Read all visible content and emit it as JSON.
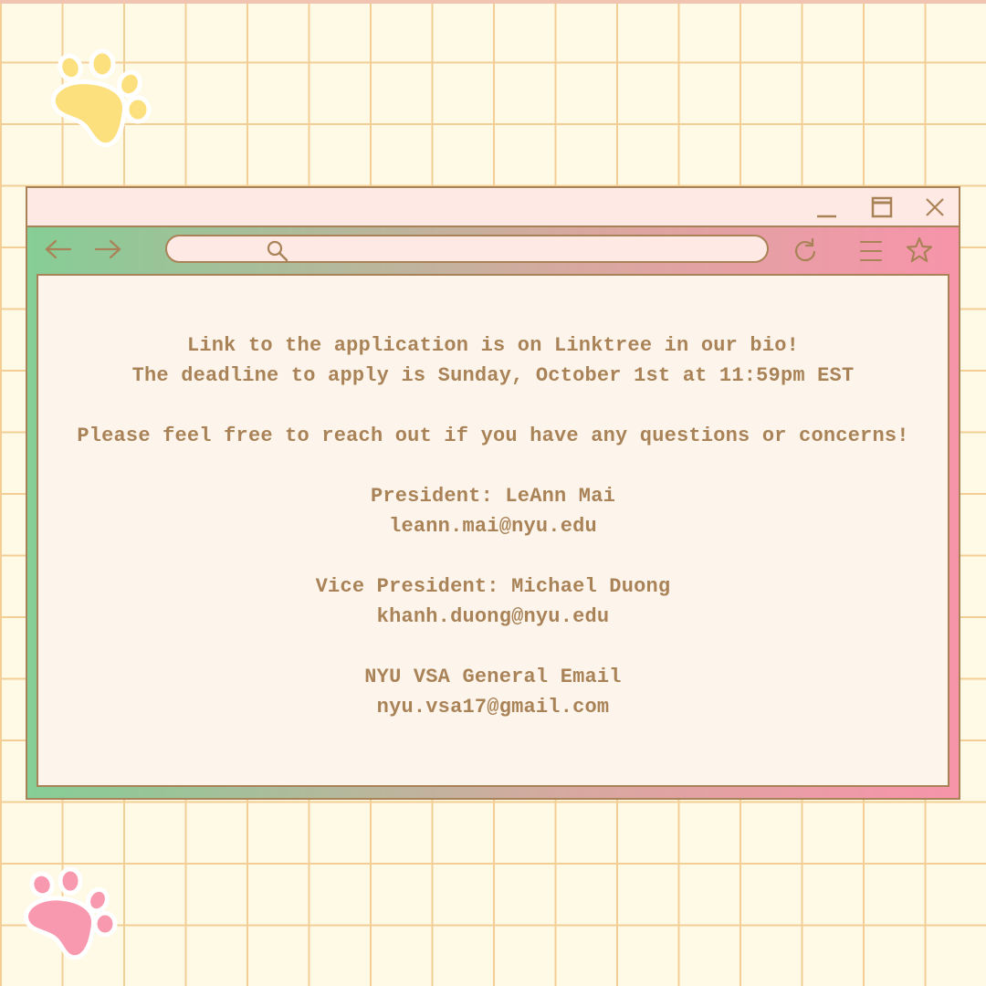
{
  "colors": {
    "background": "#fefae6",
    "grid": "#f3cf95",
    "border": "#a98357",
    "text": "#a98357",
    "titlebar": "#ffe9e4",
    "content_bg": "#fdf5ec",
    "gradient_left": "#86cd96",
    "gradient_right": "#f794aa",
    "paw_yellow": "#fde07e",
    "paw_pink": "#f899b0"
  },
  "icons": {
    "window_controls": [
      "minimize-icon",
      "maximize-icon",
      "close-icon"
    ],
    "toolbar": [
      "back-arrow-icon",
      "forward-arrow-icon",
      "search-icon",
      "refresh-icon",
      "menu-icon",
      "star-icon"
    ],
    "decorations": [
      "paw-print-icon"
    ]
  },
  "main": {
    "line1": "Link to the application is on Linktree in our bio!",
    "line2": "The deadline to apply is Sunday, October 1st at 11:59pm EST",
    "line3": "Please feel free to reach out if you have any questions or concerns!",
    "contacts": [
      {
        "label": "President: LeAnn Mai",
        "email": "leann.mai@nyu.edu"
      },
      {
        "label": "Vice President: Michael Duong",
        "email": "khanh.duong@nyu.edu"
      },
      {
        "label": "NYU VSA General Email",
        "email": "nyu.vsa17@gmail.com"
      }
    ]
  }
}
